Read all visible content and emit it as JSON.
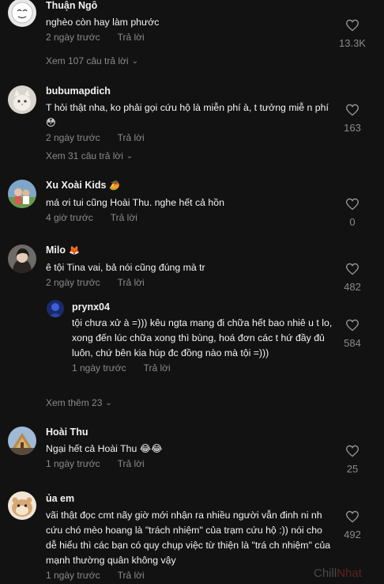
{
  "comments": [
    {
      "user": "Thuận Ngô",
      "emoji": "",
      "text": "nghèo còn hay làm phước",
      "time": "2 ngày trước",
      "reply": "Trả lời",
      "likes": "13.3K",
      "view_replies": "Xem 107 câu trả lời",
      "avatar": "face-icon"
    },
    {
      "user": "bubumapdich",
      "emoji": "",
      "text": "T hỏi thật nha, ko phải gọi cứu hộ là miễn phí à, t tưởng miễ n phí 😳",
      "time": "2 ngày trước",
      "reply": "Trả lời",
      "likes": "163",
      "view_replies": "Xem 31 câu trả lời",
      "avatar": "cat-icon"
    },
    {
      "user": "Xu Xoài Kids",
      "emoji": "🥭",
      "text": "má ơi tui cũng Hoài Thu. nghe hết cả hồn",
      "time": "4 giờ trước",
      "reply": "Trả lời",
      "likes": "0",
      "avatar": "kids-icon"
    },
    {
      "user": "Milo",
      "emoji": "🦊",
      "text": "ê tội Tina vai, bả nói cũng đúng mà tr",
      "time": "2 ngày trước",
      "reply": "Trả lời",
      "likes": "482",
      "avatar": "person-icon"
    },
    {
      "user": "prynx04",
      "emoji": "",
      "text": "tội chưa xử à =))) kêu ngta mang đi chữa hết bao nhiê u t lo, xong đến lúc chữa xong thì bùng, hoá đơn các t hứ đầy đủ luôn, chứ bên kia húp đc đồng nào mà tội =)))",
      "time": "1 ngày trước",
      "reply": "Trả lời",
      "likes": "584",
      "view_replies": "Xem thêm 23",
      "avatar": "blue-avatar-icon"
    },
    {
      "user": "Hoài Thu",
      "emoji": "",
      "text": "Ngại hết cả Hoài Thu 😂😂",
      "time": "1 ngày trước",
      "reply": "Trả lời",
      "likes": "25",
      "avatar": "temple-icon"
    },
    {
      "user": "ủa em",
      "emoji": "",
      "text": "vãi thật đọc cmt nãy giờ mới nhận ra nhiều người vẫn đinh ni nh cứu chó mèo hoang là \"trách nhiệm\" của trạm cứu hộ :)) nói cho dễ hiểu thì các bạn có quy chụp việc từ thiện là \"trá ch nhiệm\" của mạnh thường quân không vậy",
      "time": "1 ngày trước",
      "reply": "Trả lời",
      "likes": "492",
      "avatar": "hamster-icon"
    }
  ],
  "watermark": {
    "part1": "Chill",
    "part2": "Nhat"
  },
  "colors": {
    "background": "#121212",
    "muted": "#8a8a8a",
    "text": "#f4f4f4"
  }
}
